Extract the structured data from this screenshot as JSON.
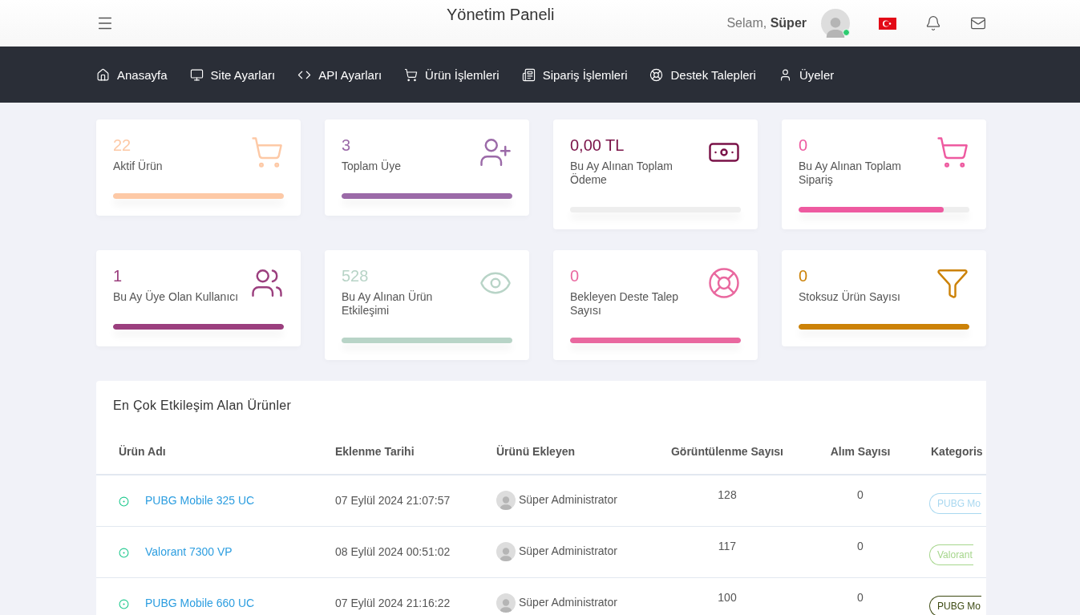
{
  "header": {
    "title": "Yönetim Paneli",
    "greeting": "Selam,",
    "user_name": "Süper",
    "online": true
  },
  "nav": [
    {
      "label": "Anasayfa",
      "kind": "home"
    },
    {
      "label": "Site Ayarları",
      "kind": "monitor"
    },
    {
      "label": "API Ayarları",
      "kind": "code"
    },
    {
      "label": "Ürün İşlemleri",
      "kind": "cart"
    },
    {
      "label": "Sipariş İşlemleri",
      "kind": "news"
    },
    {
      "label": "Destek Talepleri",
      "kind": "support"
    },
    {
      "label": "Üyeler",
      "kind": "user"
    }
  ],
  "stat_cards": [
    {
      "value": "22",
      "label": "Aktif Ürün",
      "kind": "basket",
      "color": "#fdc9a6",
      "level": 1
    },
    {
      "value": "3",
      "label": "Toplam Üye",
      "kind": "user-plus",
      "color": "#9b6aa8",
      "level": 1
    },
    {
      "value": "0,00 TL",
      "label": "Bu Ay Alınan Toplam Ödeme",
      "kind": "money",
      "color": "#7a1248",
      "level": 0
    },
    {
      "value": "0",
      "label": "Bu Ay Alınan Toplam Sipariş",
      "kind": "cart",
      "color": "#ee5aa0",
      "level": 0.85
    },
    {
      "value": "1",
      "label": "Bu Ay Üye Olan Kullanıcı",
      "kind": "users",
      "color": "#9b3f7e",
      "level": 1
    },
    {
      "value": "528",
      "label": "Bu Ay Alınan Ürün Etkileşimi",
      "kind": "eye",
      "color": "#b8d4c7",
      "level": 1
    },
    {
      "value": "0",
      "label": "Bekleyen Deste Talep Sayısı",
      "kind": "support",
      "color": "#e9689f",
      "level": 1
    },
    {
      "value": "0",
      "label": "Stoksuz Ürün Sayısı",
      "kind": "filter",
      "color": "#cc8207",
      "level": 1
    }
  ],
  "table": {
    "title": "En Çok Etkileşim Alan Ürünler",
    "columns": [
      "Ürün Adı",
      "Eklenme Tarihi",
      "Ürünü Ekleyen",
      "Görüntülenme Sayısı",
      "Alım Sayısı",
      "Kategoris"
    ],
    "rows": [
      {
        "name": "PUBG Mobile 325 UC",
        "date": "07 Eylül 2024 21:07:57",
        "added_by": "Süper Administrator",
        "views": "128",
        "purchases": "0",
        "category": "PUBG Mo",
        "color": "#a9d8f0"
      },
      {
        "name": "Valorant 7300 VP",
        "date": "08 Eylül 2024 00:51:02",
        "added_by": "Süper Administrator",
        "views": "117",
        "purchases": "0",
        "category": "Valorant",
        "color": "#a6d68c"
      },
      {
        "name": "PUBG Mobile 660 UC",
        "date": "07 Eylül 2024 21:16:22",
        "added_by": "Süper Administrator",
        "views": "100",
        "purchases": "0",
        "category": "PUBG Mo",
        "color": "#3d4a12"
      }
    ]
  }
}
